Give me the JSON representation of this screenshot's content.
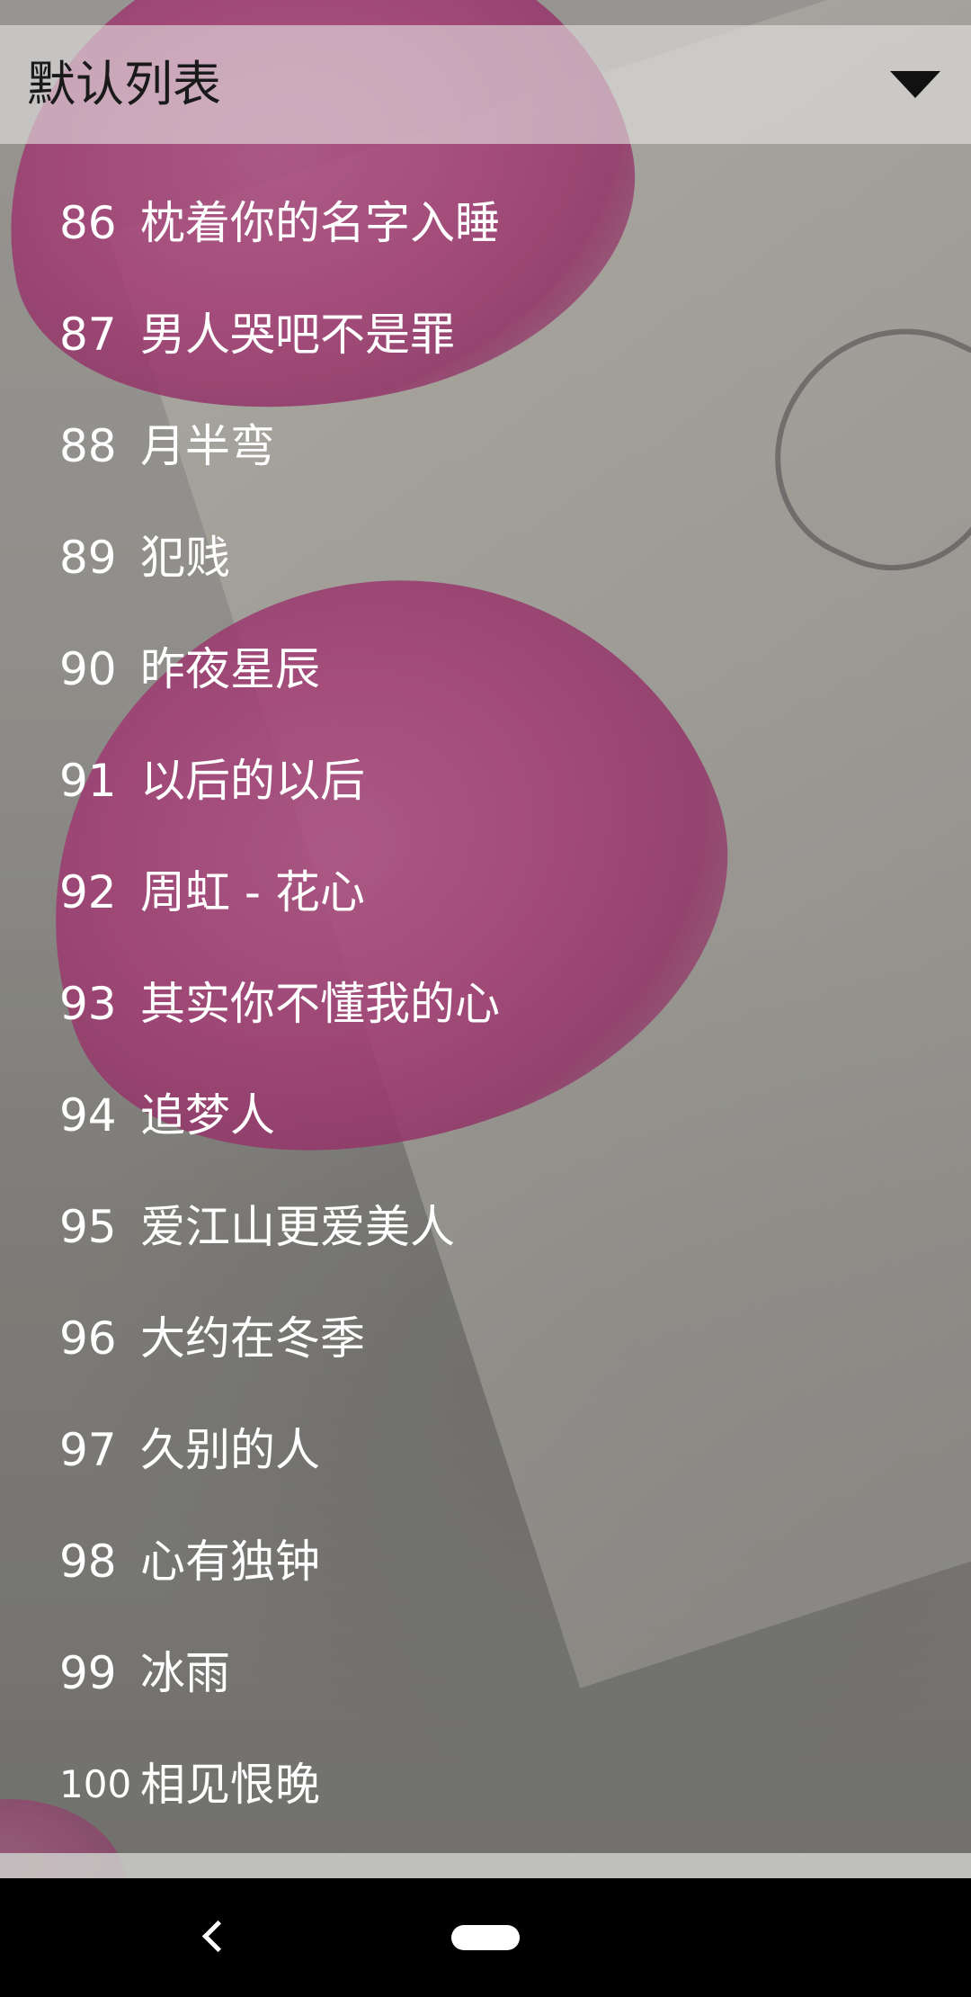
{
  "header": {
    "title": "默认列表"
  },
  "songs": [
    {
      "no": "86",
      "title": "枕着你的名字入睡"
    },
    {
      "no": "87",
      "title": "男人哭吧不是罪"
    },
    {
      "no": "88",
      "title": "月半弯"
    },
    {
      "no": "89",
      "title": "犯贱"
    },
    {
      "no": "90",
      "title": "昨夜星辰"
    },
    {
      "no": "91",
      "title": "以后的以后"
    },
    {
      "no": "92",
      "title": "周虹 - 花心"
    },
    {
      "no": "93",
      "title": "其实你不懂我的心"
    },
    {
      "no": "94",
      "title": "追梦人"
    },
    {
      "no": "95",
      "title": "爱江山更爱美人"
    },
    {
      "no": "96",
      "title": "大约在冬季"
    },
    {
      "no": "97",
      "title": "久别的人"
    },
    {
      "no": "98",
      "title": "心有独钟"
    },
    {
      "no": "99",
      "title": "冰雨"
    },
    {
      "no": "100",
      "title": "相见恨晚"
    }
  ],
  "icons": {
    "dropdown": "triangle-down-icon",
    "back": "back-chevron-icon",
    "home": "home-pill-icon"
  },
  "colors": {
    "text": "#ffffff",
    "header_text": "#1a1a1a",
    "petal": "#c64a8e",
    "navbar": "#000000"
  }
}
